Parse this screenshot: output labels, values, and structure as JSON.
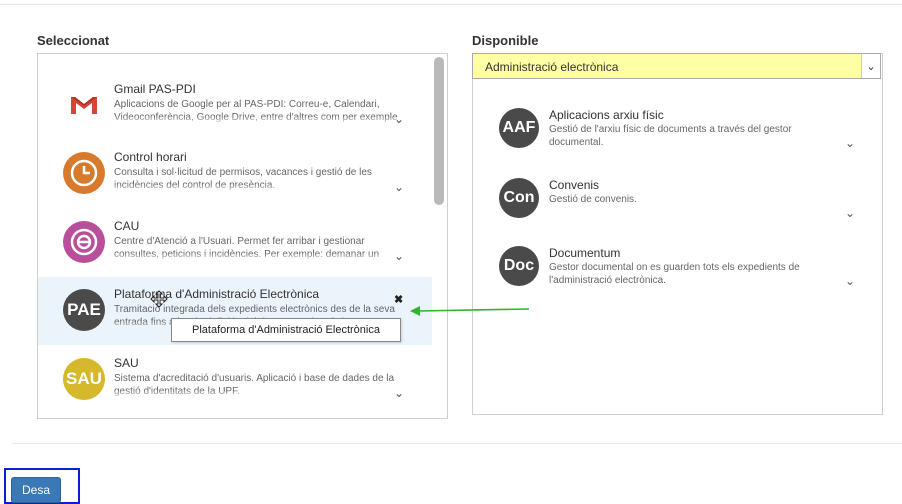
{
  "top_rule": true,
  "selected": {
    "title": "Seleccionat",
    "items": [
      {
        "name": "Gmail PAS-PDI",
        "icon": "gmail-icon",
        "icon_text": "M",
        "color": "#ffffff",
        "desc": "Aplicacions de Google per al PAS-PDI: Correu-e, Calendari, Videoconferència, Google Drive, entre d'altres com per exemple Gmail, Sites..."
      },
      {
        "name": "Control horari",
        "icon": "clock-icon",
        "icon_text": "",
        "color": "#d77a2c",
        "desc": "Consulta i sol·licitud de permisos, vacances i gestió de les incidències del control de presència."
      },
      {
        "name": "CAU",
        "icon": "cau-icon",
        "icon_text": "",
        "color": "#b94f9b",
        "desc": "Centre d'Atenció a l'Usuari. Permet fer arribar i gestionar consultes, peticions i incidències. Per exemple: demanar un compte, demanar instal·lar un programari, ..."
      },
      {
        "name": "Plataforma d'Administració Electrònica",
        "icon": "pae-icon",
        "icon_text": "PAE",
        "color": "#4a4a4a",
        "desc": "Tramitació integrada dels expedients electrònics des de la seva entrada fins a l'arxiu definitiu del document electrònic."
      },
      {
        "name": "SAU",
        "icon": "sau-icon",
        "icon_text": "SAU",
        "color": "#d6b82d",
        "desc": "Sistema d'acreditació d'usuaris. Aplicació i base de dades de la gestió d'identitats de la UPF."
      }
    ],
    "tooltip": "Plataforma d'Administració Electrònica"
  },
  "available": {
    "title": "Disponible",
    "dropdown_value": "Administració electrònica",
    "dropdown_color": "#ffffa6",
    "items": [
      {
        "name": "Aplicacions arxiu físic",
        "icon_text": "AAF",
        "desc": "Gestió de l'arxiu físic de documents a través del gestor documental."
      },
      {
        "name": "Convenis",
        "icon_text": "Con",
        "desc": "Gestió de convenis."
      },
      {
        "name": "Documentum",
        "icon_text": "Doc",
        "desc": "Gestor documental on es guarden tots els expedients de l'administració electrònica."
      }
    ]
  },
  "save_label": "Desa",
  "colors": {
    "accent": "#3a78b6",
    "arrow": "#2db52d",
    "focus": "#0a1ed6"
  }
}
